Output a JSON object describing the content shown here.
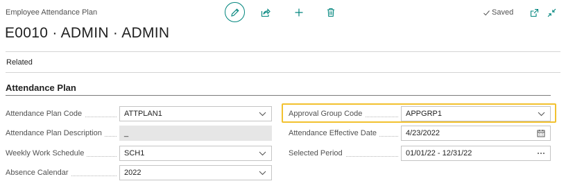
{
  "header": {
    "caption": "Employee Attendance Plan",
    "title": "E0010 · ADMIN · ADMIN",
    "saved_label": "Saved",
    "actions": [
      "edit-icon",
      "share-icon",
      "add-icon",
      "delete-icon",
      "open-new-window-icon",
      "collapse-icon"
    ]
  },
  "nav": {
    "related_label": "Related"
  },
  "section": {
    "title": "Attendance Plan"
  },
  "left_fields": [
    {
      "label": "Attendance Plan Code",
      "value": "ATTPLAN1",
      "control": "dropdown"
    },
    {
      "label": "Attendance Plan Description",
      "value": "_",
      "control": "readonly"
    },
    {
      "label": "Weekly Work Schedule",
      "value": "SCH1",
      "control": "dropdown"
    },
    {
      "label": "Absence Calendar",
      "value": "2022",
      "control": "dropdown"
    }
  ],
  "right_fields": [
    {
      "label": "Approval Group Code",
      "value": "APPGRP1",
      "control": "dropdown",
      "highlighted": true
    },
    {
      "label": "Attendance Effective Date",
      "value": "4/23/2022",
      "control": "calendar"
    },
    {
      "label": "Selected Period",
      "value": "01/01/22 - 12/31/22",
      "control": "more"
    }
  ],
  "colors": {
    "accent": "#00857d",
    "highlight": "#f2c12e",
    "readonly_bg": "#e6e6e6"
  }
}
